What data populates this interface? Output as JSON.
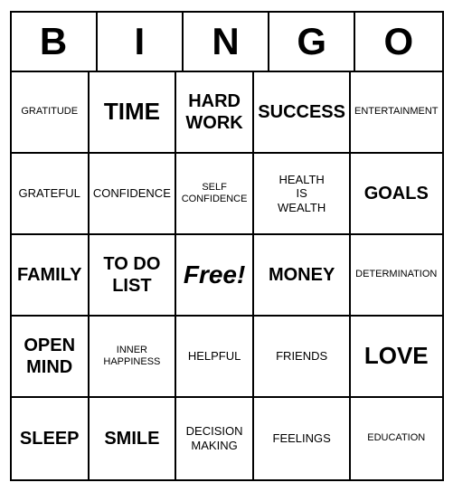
{
  "header": {
    "letters": [
      "B",
      "I",
      "N",
      "G",
      "O"
    ]
  },
  "grid": [
    [
      {
        "text": "GRATITUDE",
        "size": "xs"
      },
      {
        "text": "TIME",
        "size": "lg"
      },
      {
        "text": "HARD\nWORK",
        "size": "md"
      },
      {
        "text": "SUCCESS",
        "size": "md"
      },
      {
        "text": "ENTERTAINMENT",
        "size": "xs"
      }
    ],
    [
      {
        "text": "GRATEFUL",
        "size": "sm"
      },
      {
        "text": "CONFIDENCE",
        "size": "sm"
      },
      {
        "text": "SELF\nCONFIDENCE",
        "size": "xs"
      },
      {
        "text": "HEALTH\nIS\nWEALTH",
        "size": "sm"
      },
      {
        "text": "GOALS",
        "size": "md"
      }
    ],
    [
      {
        "text": "FAMILY",
        "size": "md"
      },
      {
        "text": "TO DO\nLIST",
        "size": "md"
      },
      {
        "text": "Free!",
        "size": "free"
      },
      {
        "text": "MONEY",
        "size": "md"
      },
      {
        "text": "DETERMINATION",
        "size": "xs"
      }
    ],
    [
      {
        "text": "OPEN\nMIND",
        "size": "md"
      },
      {
        "text": "INNER\nHAPPINESS",
        "size": "xs"
      },
      {
        "text": "HELPFUL",
        "size": "sm"
      },
      {
        "text": "FRIENDS",
        "size": "sm"
      },
      {
        "text": "LOVE",
        "size": "lg"
      }
    ],
    [
      {
        "text": "SLEEP",
        "size": "md"
      },
      {
        "text": "SMILE",
        "size": "md"
      },
      {
        "text": "DECISION\nMAKING",
        "size": "sm"
      },
      {
        "text": "FEELINGS",
        "size": "sm"
      },
      {
        "text": "EDUCATION",
        "size": "xs"
      }
    ]
  ]
}
